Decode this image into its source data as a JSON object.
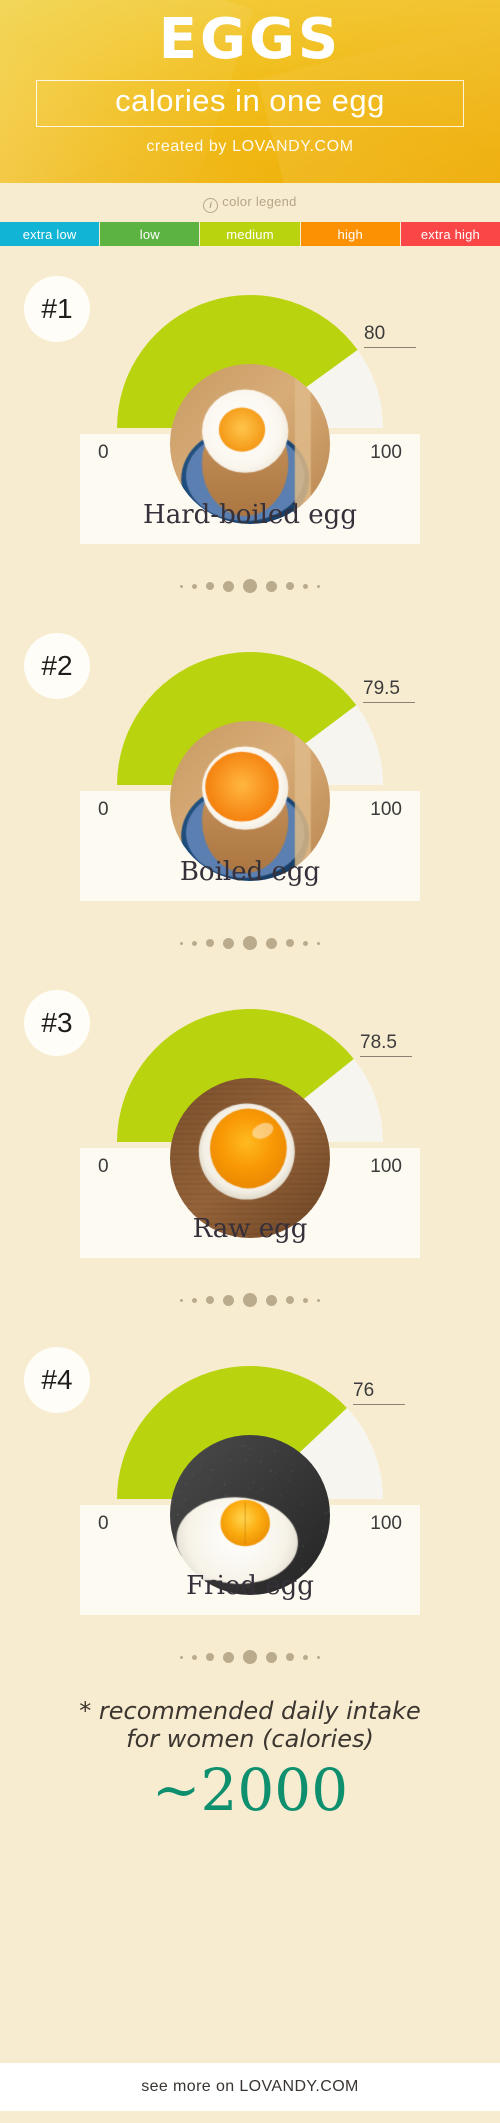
{
  "header": {
    "title": "EGGS",
    "subtitle": "calories in one egg",
    "created_by": "created by LOVANDY.COM",
    "bg_start": "#f0cd33",
    "bg_end": "#eeac06"
  },
  "legend": {
    "caption": "color legend",
    "icon": "info-icon",
    "items": [
      {
        "label": "extra low",
        "color": "#11b4d4"
      },
      {
        "label": "low",
        "color": "#5cb342"
      },
      {
        "label": "medium",
        "color": "#b9d40f"
      },
      {
        "label": "high",
        "color": "#fc9104"
      },
      {
        "label": "extra high",
        "color": "#fa4646"
      }
    ]
  },
  "cards": [
    {
      "rank": "#1",
      "value": "80",
      "value_num": 80,
      "scale_min": "0",
      "scale_max": "100",
      "title": "Hard-boiled egg",
      "arc_color": "#b9d40f",
      "photo": "hard-boiled-egg-photo"
    },
    {
      "rank": "#2",
      "value": "79.5",
      "value_num": 79.5,
      "scale_min": "0",
      "scale_max": "100",
      "title": "Boiled egg",
      "arc_color": "#b9d40f",
      "photo": "boiled-egg-photo"
    },
    {
      "rank": "#3",
      "value": "78.5",
      "value_num": 78.5,
      "scale_min": "0",
      "scale_max": "100",
      "title": "Raw egg",
      "arc_color": "#b9d40f",
      "photo": "raw-egg-photo"
    },
    {
      "rank": "#4",
      "value": "76",
      "value_num": 76,
      "scale_min": "0",
      "scale_max": "100",
      "title": "Fried egg",
      "arc_color": "#b9d40f",
      "photo": "fried-egg-photo"
    }
  ],
  "separator": {
    "dot_sizes": [
      3,
      5,
      8,
      11,
      14,
      11,
      8,
      5,
      3
    ],
    "color": "#b9ab8c"
  },
  "footer": {
    "note_line1": "* recommended daily intake",
    "note_line2": "for women (calories)",
    "value": "~2000",
    "value_color": "#0e8f6e",
    "see_more": "see more on LOVANDY.COM"
  },
  "chart_data": {
    "type": "bar",
    "title": "EGGS — calories in one egg",
    "categories": [
      "Hard-boiled egg",
      "Boiled egg",
      "Raw egg",
      "Fried egg"
    ],
    "values": [
      80,
      79.5,
      78.5,
      76
    ],
    "xlabel": "",
    "ylabel": "calories",
    "ylim": [
      0,
      100
    ],
    "gauge_min": 0,
    "gauge_max": 100,
    "legend_bands": [
      "extra low",
      "low",
      "medium",
      "high",
      "extra high"
    ],
    "annotations": [
      "* recommended daily intake for women (calories) ~2000"
    ]
  }
}
